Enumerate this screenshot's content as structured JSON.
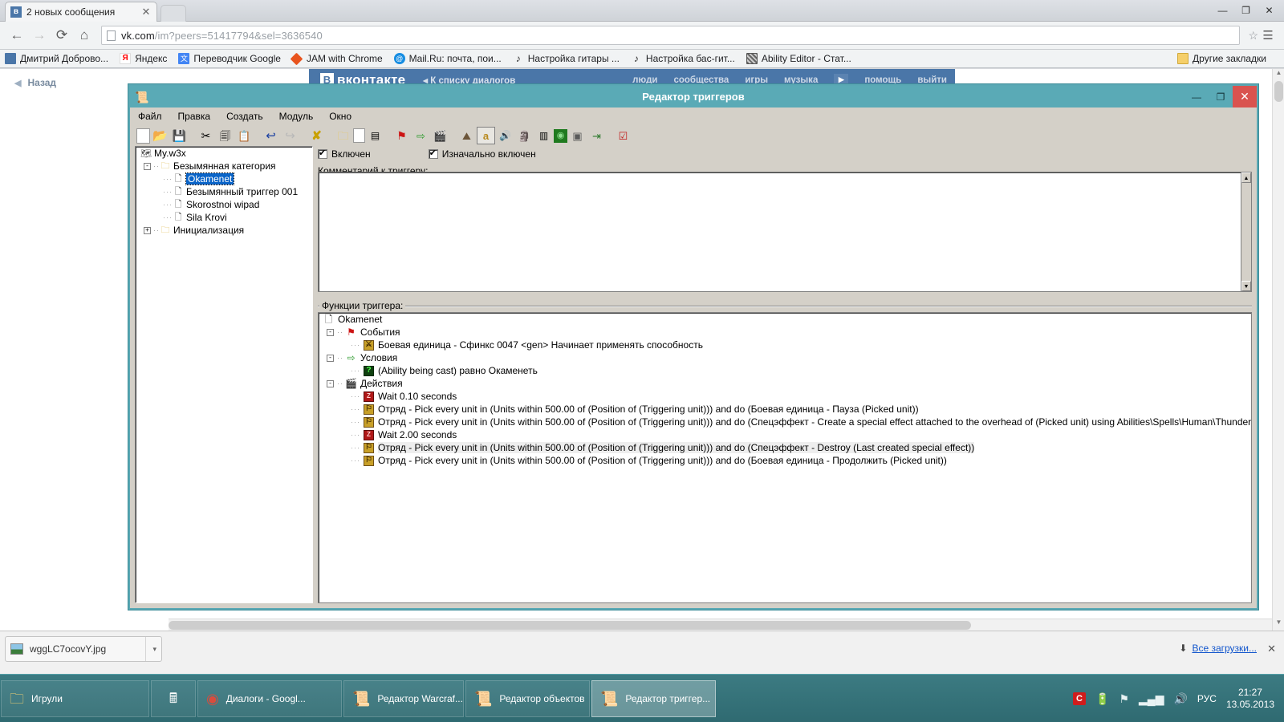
{
  "browser": {
    "tab": {
      "title": "2 новых сообщения",
      "favicon_letter": "в",
      "close_icon": "✕"
    },
    "nav": {
      "back": "←",
      "forward": "→",
      "reload": "⟳",
      "home": "⌂"
    },
    "omnibox": {
      "url_host": "vk.com",
      "url_path": "/im?peers=51417794&sel=3636540",
      "star_icon": "☆",
      "menu_icon": "☰"
    },
    "window_controls": {
      "minimize": "—",
      "maximize": "❐",
      "close": "✕"
    },
    "bookmarks": [
      {
        "label": "Дмитрий Доброво...",
        "icon": "bookmark-icon-vk",
        "color": "#4a76a8"
      },
      {
        "label": "Яндекс",
        "icon": "bookmark-icon-yandex",
        "color": "#ffffff"
      },
      {
        "label": "Переводчик Google",
        "icon": "bookmark-icon-translate",
        "color": "#4285f4"
      },
      {
        "label": "JAM with Chrome",
        "icon": "bookmark-icon-jam",
        "color": "#e8541e"
      },
      {
        "label": "Mail.Ru: почта, пои...",
        "icon": "bookmark-icon-mailru",
        "color": "#168de2"
      },
      {
        "label": "Настройка гитары ...",
        "icon": "bookmark-icon-note",
        "color": "#333333"
      },
      {
        "label": "Настройка бас-гит...",
        "icon": "bookmark-icon-note",
        "color": "#333333"
      },
      {
        "label": "Ability Editor - Стат...",
        "icon": "bookmark-icon-ability",
        "color": "#7a7a7a"
      }
    ],
    "other_bookmarks": {
      "label": "Другие закладки",
      "icon": "folder-icon"
    }
  },
  "vk_page": {
    "back_link": "Назад",
    "logo": "вконтакте",
    "dialogs_link": "К списку диалогов",
    "nav": [
      "люди",
      "сообщества",
      "игры",
      "музыка",
      "помощь",
      "выйти"
    ]
  },
  "downloads": {
    "file_name": "wggLC7ocovY.jpg",
    "caret": "▾",
    "show_all": "Все загрузки...",
    "show_all_icon": "⬇",
    "close_icon": "✕"
  },
  "trigger_editor": {
    "title": "Редактор триггеров",
    "title_icon": "📜",
    "window_controls": {
      "minimize": "—",
      "maximize": "❐",
      "close": "✕"
    },
    "menu": [
      "Файл",
      "Правка",
      "Создать",
      "Модуль",
      "Окно"
    ],
    "toolbar": [
      {
        "name": "new-icon",
        "glyph": "🗋"
      },
      {
        "name": "open-icon",
        "glyph": "📂"
      },
      {
        "name": "save-icon",
        "glyph": "💾"
      },
      {
        "name": "cut-icon",
        "glyph": "✂"
      },
      {
        "name": "copy-icon",
        "glyph": "⧉"
      },
      {
        "name": "paste-icon",
        "glyph": "📋"
      },
      {
        "name": "undo-icon",
        "glyph": "↩"
      },
      {
        "name": "redo-icon",
        "glyph": "↪"
      },
      {
        "name": "close-map-icon",
        "glyph": "X"
      },
      {
        "name": "new-category-icon",
        "glyph": "🗀"
      },
      {
        "name": "new-trigger-icon",
        "glyph": "🗋"
      },
      {
        "name": "new-comment-icon",
        "glyph": "☰"
      },
      {
        "name": "new-event-icon",
        "glyph": "⚑"
      },
      {
        "name": "new-condition-icon",
        "glyph": "⇨"
      },
      {
        "name": "new-action-icon",
        "glyph": "🎬"
      },
      {
        "name": "terrain-editor-icon",
        "glyph": "⛰"
      },
      {
        "name": "trigger-editor-icon",
        "glyph": "a"
      },
      {
        "name": "sound-editor-icon",
        "glyph": "🔊"
      },
      {
        "name": "object-editor-icon",
        "glyph": "🗿"
      },
      {
        "name": "campaign-editor-icon",
        "glyph": "▤"
      },
      {
        "name": "ai-editor-icon",
        "glyph": "👹"
      },
      {
        "name": "object-manager-icon",
        "glyph": "◰"
      },
      {
        "name": "import-manager-icon",
        "glyph": "⇥"
      },
      {
        "name": "test-map-icon",
        "glyph": "☑"
      }
    ],
    "tree": {
      "root": {
        "label": "My.w3x",
        "icon": "map-icon"
      },
      "items": [
        {
          "label": "Безымянная категория",
          "icon": "folder-icon",
          "expander": "-",
          "depth": 1,
          "selected": false
        },
        {
          "label": "Okamenet",
          "icon": "trigger-icon",
          "expander": "",
          "depth": 2,
          "selected": true
        },
        {
          "label": "Безымянный триггер 001",
          "icon": "trigger-icon",
          "expander": "",
          "depth": 2,
          "selected": false
        },
        {
          "label": "Skorostnoi wipad",
          "icon": "trigger-icon",
          "expander": "",
          "depth": 2,
          "selected": false
        },
        {
          "label": "Sila Krovi",
          "icon": "trigger-icon",
          "expander": "",
          "depth": 2,
          "selected": false
        },
        {
          "label": "Инициализация",
          "icon": "folder-icon",
          "expander": "+",
          "depth": 1,
          "selected": false
        }
      ]
    },
    "checkboxes": [
      {
        "label": "Включен",
        "checked": true
      },
      {
        "label": "Изначально включен",
        "checked": true
      }
    ],
    "comment_label": "Комментарий к триггеру:",
    "comment_value": "",
    "functions_legend": "Функции триггера:",
    "functions": {
      "root_label": "Okamenet",
      "groups": [
        {
          "label": "События",
          "icon": "event-flag-icon",
          "expander": "-",
          "rows": [
            {
              "text": "Боевая единица - Сфинкс 0047 <gen> Начинает применять способность",
              "icon": "unit-icon",
              "highlight": false
            }
          ]
        },
        {
          "label": "Условия",
          "icon": "condition-arrow-icon",
          "expander": "-",
          "rows": [
            {
              "text": "(Ability being cast) равно Окаменеть",
              "icon": "question-icon",
              "highlight": false
            }
          ]
        },
        {
          "label": "Действия",
          "icon": "action-clapper-icon",
          "expander": "-",
          "rows": [
            {
              "text": "Wait 0.10 seconds",
              "icon": "wait-icon",
              "highlight": false
            },
            {
              "text": "Отряд - Pick every unit in (Units within 500.00 of (Position of (Triggering unit))) and do (Боевая единица - Пауза (Picked unit))",
              "icon": "group-icon",
              "highlight": false
            },
            {
              "text": "Отряд - Pick every unit in (Units within 500.00 of (Position of (Triggering unit))) and do (Спецэффект - Create a special effect attached to the overhead of (Picked unit) using Abilities\\Spells\\Human\\Thunderclap\\ThunderclapTarget.mdl)",
              "icon": "group-icon",
              "highlight": false
            },
            {
              "text": "Wait 2.00 seconds",
              "icon": "wait-icon",
              "highlight": false
            },
            {
              "text": "Отряд - Pick every unit in (Units within 500.00 of (Position of (Triggering unit))) and do (Спецэффект - Destroy (Last created special effect))",
              "icon": "group-icon",
              "highlight": true
            },
            {
              "text": "Отряд - Pick every unit in (Units within 500.00 of (Position of (Triggering unit))) and do (Боевая единица - Продолжить (Picked unit))",
              "icon": "group-icon",
              "highlight": false
            }
          ]
        }
      ]
    }
  },
  "taskbar": {
    "items": [
      {
        "label": "Игрули",
        "icon": "folder-icon",
        "active": false,
        "start": true
      },
      {
        "label": "",
        "icon": "calculator-icon",
        "active": false
      },
      {
        "label": "Диалоги - Googl...",
        "icon": "chrome-icon",
        "active": false
      },
      {
        "label": "Редактор Warcraf...",
        "icon": "scroll-icon",
        "active": false
      },
      {
        "label": "Редактор объектов",
        "icon": "scroll-icon",
        "active": false
      },
      {
        "label": "Редактор триггер...",
        "icon": "scroll-icon",
        "active": true
      }
    ],
    "tray": {
      "icons": [
        "comodo-icon",
        "battery-icon",
        "network-flag-icon",
        "signal-icon",
        "volume-icon"
      ],
      "language": "РУС",
      "time": "21:27",
      "date": "13.05.2013"
    }
  }
}
